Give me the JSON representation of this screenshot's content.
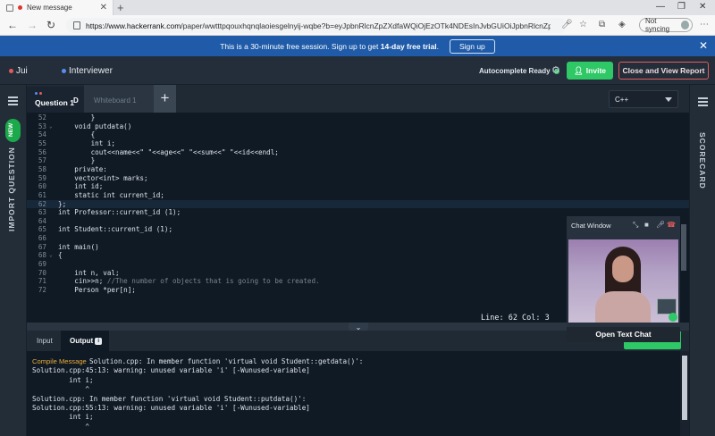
{
  "browser": {
    "tab_title": "New message",
    "new_tab_symbol": "+",
    "url_host": "https://www.hackerrank.com",
    "url_path": "/paper/wwtttpqouxhqnqlaoiesgelnyij-wqbe?b=eyJpbnRlcnZpZXdfaWQiOjEzOTk4NDEsInJvbGUiOiJpbnRlcnZpZ...",
    "sync_label": "Not syncing"
  },
  "banner": {
    "text_before": "This is a 30-minute free session. Sign up to get ",
    "text_bold": "14-day free trial",
    "text_after": ".",
    "signup_label": "Sign up"
  },
  "header": {
    "user1": "Jui",
    "user2": "Interviewer",
    "autocomplete_label": "Autocomplete Ready",
    "invite_label": "Invite",
    "close_report_label": "Close and View Report"
  },
  "sidebar": {
    "new_badge": "NEW",
    "import_label": "IMPORT QUESTION",
    "scorecard_label": "SCORECARD"
  },
  "editor_tabs": {
    "question_tab": "Question 1",
    "question_icon": "D",
    "whiteboard_tab": "Whiteboard 1",
    "add_symbol": "+",
    "language": "C++"
  },
  "code_lines": [
    {
      "n": "52",
      "fold": "",
      "text": "        }"
    },
    {
      "n": "53",
      "fold": "v",
      "text": "    void putdata()"
    },
    {
      "n": "54",
      "fold": "",
      "text": "        {"
    },
    {
      "n": "55",
      "fold": "",
      "text": "        int i;"
    },
    {
      "n": "56",
      "fold": "",
      "text": "        cout<<name<<\" \"<<age<<\" \"<<sum<<\" \"<<id<<endl;"
    },
    {
      "n": "57",
      "fold": "",
      "text": "        }"
    },
    {
      "n": "58",
      "fold": "",
      "text": "    private:"
    },
    {
      "n": "59",
      "fold": "",
      "text": "    vector<int> marks;"
    },
    {
      "n": "60",
      "fold": "",
      "text": "    int id;"
    },
    {
      "n": "61",
      "fold": "",
      "text": "    static int current_id;"
    },
    {
      "n": "62",
      "fold": "",
      "text": "};"
    },
    {
      "n": "63",
      "fold": "",
      "text": "int Professor::current_id (1);"
    },
    {
      "n": "64",
      "fold": "",
      "text": ""
    },
    {
      "n": "65",
      "fold": "",
      "text": "int Student::current_id (1);"
    },
    {
      "n": "66",
      "fold": "",
      "text": ""
    },
    {
      "n": "67",
      "fold": "",
      "text": "int main()"
    },
    {
      "n": "68",
      "fold": "v",
      "text": "{"
    },
    {
      "n": "69",
      "fold": "",
      "text": ""
    },
    {
      "n": "70",
      "fold": "",
      "text": "    int n, val;"
    },
    {
      "n": "71",
      "fold": "",
      "text": "    cin>>n; ",
      "comment": "//The number of objects that is going to be created."
    },
    {
      "n": "72",
      "fold": "",
      "text": "    Person *per[n];"
    }
  ],
  "cursor_info": "Line: 62 Col: 3",
  "output": {
    "input_tab": "Input",
    "output_tab": "Output",
    "output_badge": "i",
    "compile_label": "Compile Message",
    "lines": [
      "Solution.cpp: In member function 'virtual void Student::getdata()':",
      "Solution.cpp:45:13: warning: unused variable 'i' [-Wunused-variable]",
      "         int i;",
      "             ^",
      "Solution.cpp: In member function 'virtual void Student::putdata()':",
      "Solution.cpp:55:13: warning: unused variable 'i' [-Wunused-variable]",
      "         int i;",
      "             ^"
    ]
  },
  "chat": {
    "title": "Chat Window",
    "open_text_chat": "Open Text Chat"
  },
  "colors": {
    "accent_green": "#2ec866",
    "banner_blue": "#1f5ba8",
    "editor_bg": "#0f1a25",
    "close_border": "#e05d5d"
  }
}
